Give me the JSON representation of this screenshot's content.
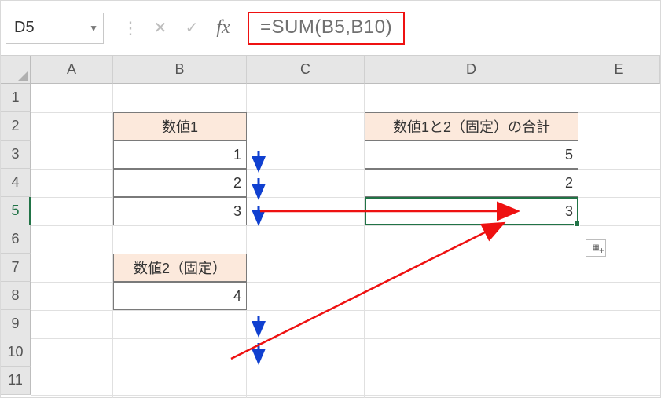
{
  "namebox": {
    "value": "D5"
  },
  "formula": "=SUM(B5,B10)",
  "columns": [
    "A",
    "B",
    "C",
    "D",
    "E"
  ],
  "rows": [
    "1",
    "2",
    "3",
    "4",
    "5",
    "6",
    "7",
    "8",
    "9",
    "10",
    "11"
  ],
  "selected_cell": "D5",
  "cells": {
    "B2": "数値1",
    "B3": "1",
    "B4": "2",
    "B5": "3",
    "B7": "数値2（固定）",
    "B8": "4",
    "D2": "数値1と2（固定）の合計",
    "D3": "5",
    "D4": "2",
    "D5": "3"
  },
  "icons": {
    "cancel": "✕",
    "enter": "✓",
    "fx": "fx",
    "dropdown": "▼",
    "dots": "⋮"
  },
  "autofill_tooltip": "⊞"
}
